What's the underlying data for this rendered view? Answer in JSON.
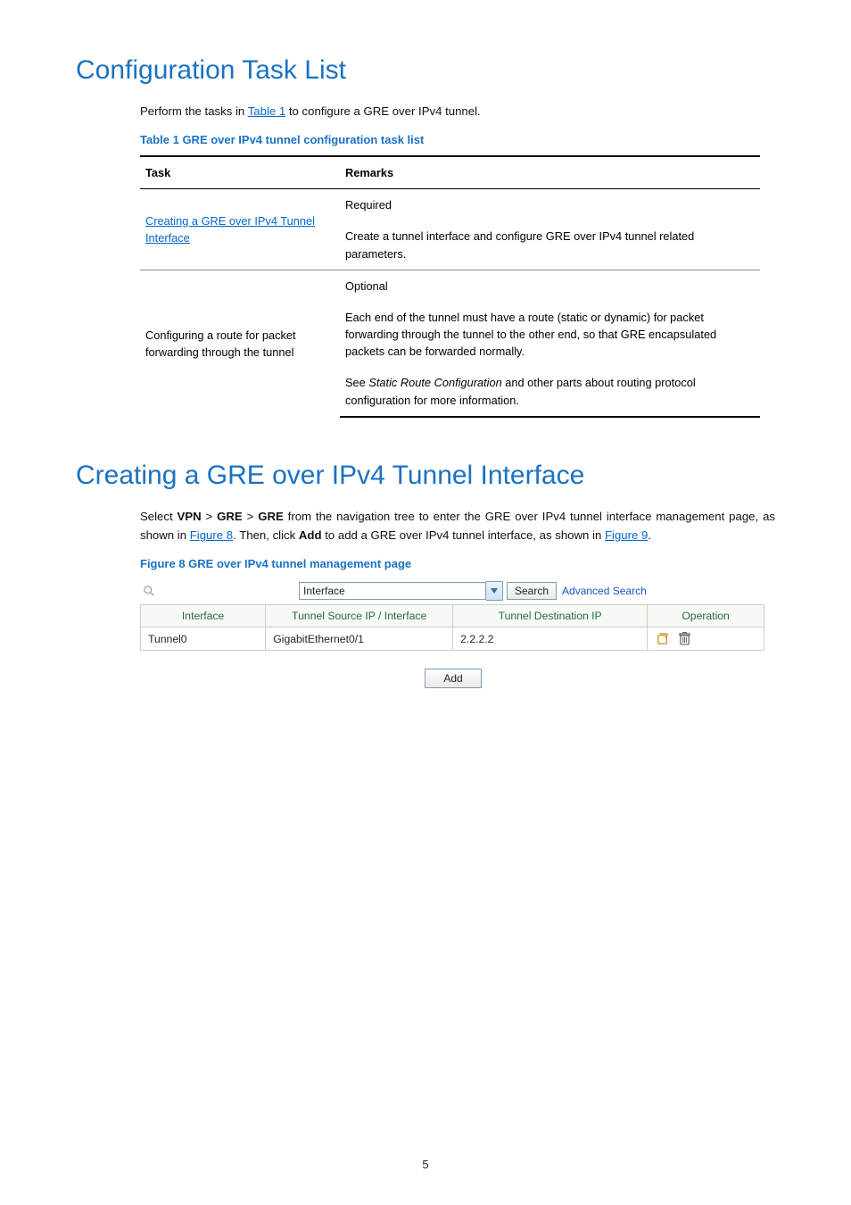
{
  "headings": {
    "h1": "Configuration Task List",
    "h2": "Creating a GRE over IPv4 Tunnel Interface"
  },
  "intro1_pre": "Perform the tasks in ",
  "intro1_link": "Table 1",
  "intro1_post": " to configure a GRE over IPv4 tunnel.",
  "table1": {
    "caption": "Table 1 GRE over IPv4 tunnel configuration task list",
    "head_task": "Task",
    "head_remarks": "Remarks",
    "row1_task_link": "Creating a GRE over IPv4 Tunnel Interface",
    "row1_r1": "Required",
    "row1_r2": "Create a tunnel interface and configure GRE over IPv4 tunnel related parameters.",
    "row2_task": "Configuring a route for packet forwarding through the tunnel",
    "row2_r1": "Optional",
    "row2_r2": "Each end of the tunnel must have a route (static or dynamic) for packet forwarding through the tunnel to the other end, so that GRE encapsulated packets can be forwarded normally.",
    "row2_r3_pre": "See ",
    "row2_r3_italic": "Static Route Configuration",
    "row2_r3_post": " and other parts about routing protocol configuration for more information."
  },
  "section2": {
    "p1_pre": "Select ",
    "vpn": "VPN",
    "sep": " > ",
    "gre": "GRE",
    "p1_mid1": " from the navigation tree to enter the GRE over IPv4 tunnel interface management page, as shown in ",
    "fig8_link": "Figure 8",
    "p1_mid2": ". Then, click ",
    "add_bold": "Add",
    "p1_mid3": " to add a GRE over IPv4 tunnel interface, as shown in ",
    "fig9_link": "Figure 9",
    "p1_end": "."
  },
  "figure8": {
    "caption": "Figure 8 GRE over IPv4 tunnel management page",
    "search_field": "Interface",
    "search_btn": "Search",
    "adv_search": "Advanced Search",
    "cols": {
      "interface": "Interface",
      "src": "Tunnel Source IP / Interface",
      "dst": "Tunnel Destination IP",
      "op": "Operation"
    },
    "row": {
      "interface": "Tunnel0",
      "src": "GigabitEthernet0/1",
      "dst": "2.2.2.2"
    },
    "add_btn": "Add"
  },
  "page_number": "5"
}
